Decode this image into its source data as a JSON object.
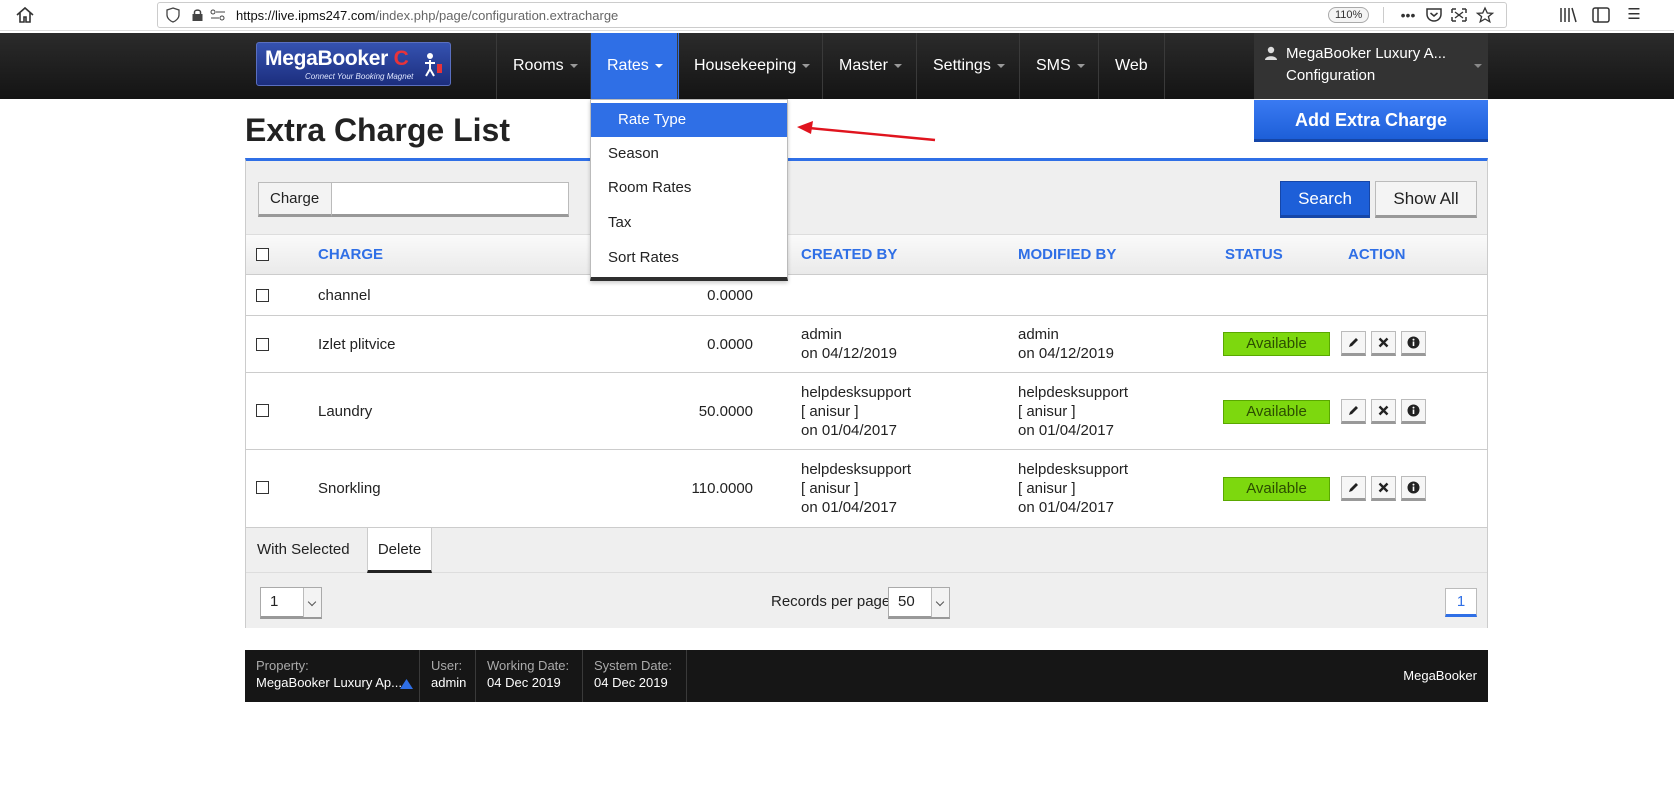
{
  "browser": {
    "url_host": "https://live.ipms247.com",
    "url_path": "/index.php/page/configuration.extracharge",
    "zoom": "110%"
  },
  "brand": {
    "name": "MegaBooker",
    "tagline": "Connect Your Booking Magnet"
  },
  "nav": {
    "items": [
      "Rooms",
      "Rates",
      "Housekeeping",
      "Master",
      "Settings",
      "SMS",
      "Web"
    ],
    "active": "Rates",
    "user_name": "MegaBooker Luxury A...",
    "user_sub": "Configuration"
  },
  "rates_menu": [
    "Rate Type",
    "Season",
    "Room Rates",
    "Tax",
    "Sort Rates"
  ],
  "page": {
    "title": "Extra Charge List",
    "add_button": "Add Extra Charge"
  },
  "filter": {
    "label": "Charge",
    "value": "",
    "search": "Search",
    "show_all": "Show All"
  },
  "table": {
    "headers": [
      "CHARGE",
      "CREATED BY",
      "MODIFIED BY",
      "STATUS",
      "ACTION"
    ],
    "rows": [
      {
        "charge": "channel",
        "amount": "0.0000",
        "created": [],
        "modified": [],
        "status": ""
      },
      {
        "charge": "Izlet plitvice",
        "amount": "0.0000",
        "created": [
          "admin",
          "on 04/12/2019"
        ],
        "modified": [
          "admin",
          "on 04/12/2019"
        ],
        "status": "Available"
      },
      {
        "charge": "Laundry",
        "amount": "50.0000",
        "created": [
          "helpdesksupport",
          "[ anisur ]",
          "on 01/04/2017"
        ],
        "modified": [
          "helpdesksupport",
          "[ anisur ]",
          "on 01/04/2017"
        ],
        "status": "Available"
      },
      {
        "charge": "Snorkling",
        "amount": "110.0000",
        "created": [
          "helpdesksupport",
          "[ anisur ]",
          "on 01/04/2017"
        ],
        "modified": [
          "helpdesksupport",
          "[ anisur ]",
          "on 01/04/2017"
        ],
        "status": "Available"
      }
    ]
  },
  "bulk": {
    "label": "With Selected",
    "delete": "Delete"
  },
  "pager": {
    "page_select": "1",
    "records_label": "Records per page",
    "records_value": "50",
    "current_page": "1"
  },
  "footer": {
    "property_label": "Property:",
    "property_value": "MegaBooker Luxury Ap...",
    "user_label": "User:",
    "user_value": "admin",
    "working_label": "Working Date:",
    "working_value": "04 Dec 2019",
    "system_label": "System Date:",
    "system_value": "04 Dec 2019",
    "brand": "MegaBooker"
  },
  "colors": {
    "accent": "#2f6fe6",
    "status_available": "#7dd80e",
    "navbar": "#1e1e1e",
    "annotation_arrow": "#e0141e"
  }
}
